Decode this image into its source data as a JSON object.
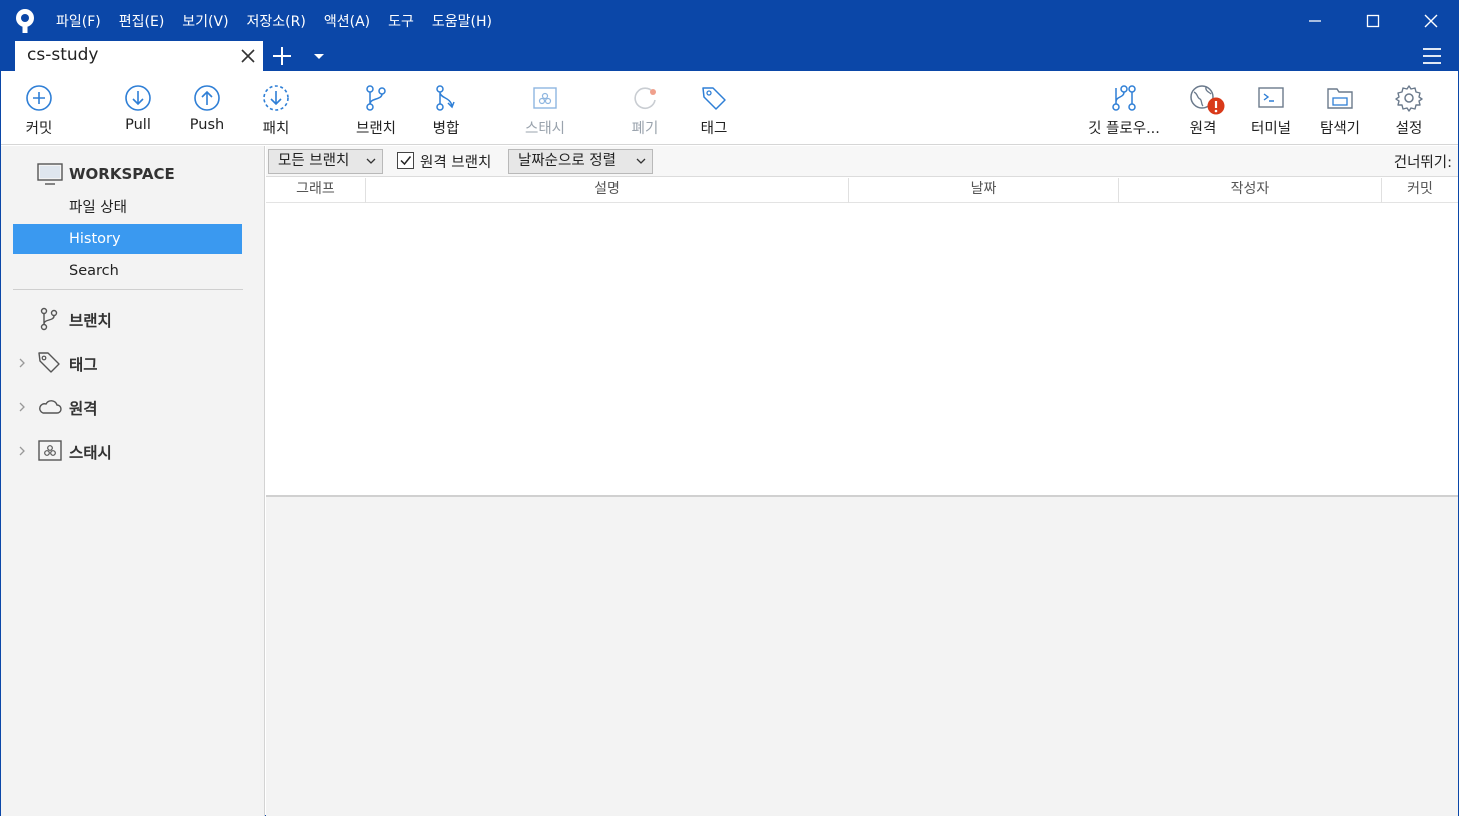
{
  "menu": [
    "파일(F)",
    "편집(E)",
    "보기(V)",
    "저장소(R)",
    "액션(A)",
    "도구",
    "도움말(H)"
  ],
  "tab": {
    "title": "cs-study"
  },
  "toolbar": {
    "commit": "커밋",
    "pull": "Pull",
    "push": "Push",
    "fetch": "패치",
    "branch": "브랜치",
    "merge": "병합",
    "stash": "스태시",
    "discard": "폐기",
    "tag": "태그",
    "gitflow": "깃 플로우...",
    "remote": "원격",
    "terminal": "터미널",
    "explorer": "탐색기",
    "settings": "설정"
  },
  "sidebar": {
    "workspace": "WORKSPACE",
    "items": [
      "파일 상태",
      "History",
      "Search"
    ],
    "active_item": "History",
    "groups": [
      "브랜치",
      "태그",
      "원격",
      "스태시"
    ]
  },
  "filters": {
    "branch_select": "모든 브랜치",
    "remote_branch_label": "원격 브랜치",
    "remote_branch_checked": true,
    "sort_select": "날짜순으로 정렬",
    "skip_label": "건너뛰기:"
  },
  "columns": [
    "그래프",
    "설명",
    "날짜",
    "작성자",
    "커밋"
  ],
  "colors": {
    "titlebar": "#0b47a8",
    "accent": "#3a99f0",
    "icon_blue": "#2f7fd6",
    "badge_red": "#d93a1a"
  }
}
